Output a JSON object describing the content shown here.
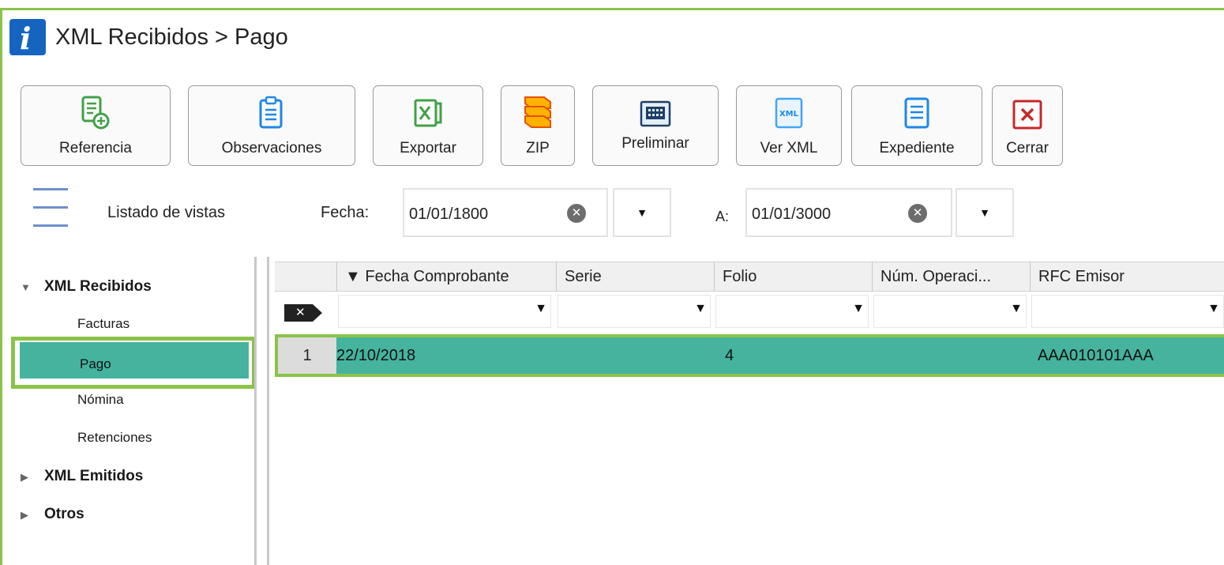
{
  "title": "XML Recibidos > Pago",
  "toolbar": {
    "buttons": [
      {
        "label": "Referencia",
        "icon": "document-add-icon"
      },
      {
        "label": "Observaciones",
        "icon": "clipboard-icon"
      },
      {
        "label": "Exportar",
        "icon": "excel-icon"
      },
      {
        "label": "ZIP",
        "icon": "zip-stack-icon"
      },
      {
        "label": "Preliminar",
        "icon": "preview-icon"
      },
      {
        "label": "Ver XML",
        "icon": "xml-file-icon"
      },
      {
        "label": "Expediente",
        "icon": "file-list-icon"
      },
      {
        "label": "Cerrar",
        "icon": "close-icon"
      }
    ]
  },
  "filters": {
    "views_label": "Listado de vistas",
    "fecha_label": "Fecha:",
    "fecha_from": "01/01/1800",
    "a_label": "A:",
    "fecha_to": "01/01/3000"
  },
  "sidebar": {
    "groups": [
      {
        "label": "XML Recibidos",
        "expanded": true,
        "items": [
          "Facturas",
          "Pago",
          "Nómina",
          "Retenciones"
        ]
      },
      {
        "label": "XML Emitidos",
        "expanded": false
      },
      {
        "label": "Otros",
        "expanded": false
      }
    ],
    "selected": "Pago"
  },
  "grid": {
    "columns": [
      "▼ Fecha Comprobante",
      "Serie",
      "Folio",
      "Núm. Operaci...",
      "RFC Emisor"
    ],
    "filter_clear": "✕",
    "rows": [
      {
        "num": "1",
        "fecha": "22/10/2018",
        "serie": "",
        "folio": "4",
        "num_operacion": "",
        "rfc_emisor": "AAA010101AAA"
      }
    ]
  },
  "colors": {
    "accent_green": "#8bc34a",
    "selection_teal": "#45b39d",
    "logo_blue": "#1565c0"
  }
}
